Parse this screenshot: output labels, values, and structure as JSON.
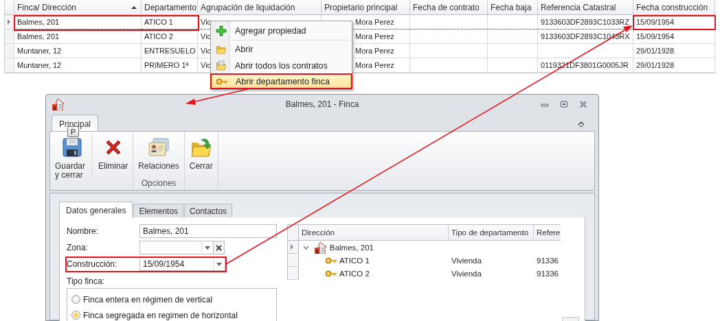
{
  "grid": {
    "columns": [
      {
        "label": "Finca/ Dirección",
        "sorted": true
      },
      {
        "label": "Departamento",
        "sorted": false
      },
      {
        "label": "Agrupación de liquidación",
        "sorted": false
      },
      {
        "label": "Propietario principal",
        "sorted": false
      },
      {
        "label": "Fecha de contrato",
        "sorted": false
      },
      {
        "label": "Fecha baja",
        "sorted": false
      },
      {
        "label": "Referencia Catastral",
        "sorted": false
      },
      {
        "label": "Fecha construcción",
        "sorted": false
      }
    ],
    "rows": [
      {
        "selected": true,
        "cells": [
          "Balmes, 201",
          "ATICO 1",
          "Vic",
          "Mora Perez",
          "",
          "",
          "9133603DF2893C1033RZ",
          "15/09/1954"
        ]
      },
      {
        "selected": false,
        "cells": [
          "Balmes, 201",
          "ATICO 2",
          "Vic",
          "Mora Perez",
          "",
          "",
          "9133603DF2893C1043RX",
          "15/09/1954"
        ]
      },
      {
        "selected": false,
        "cells": [
          "Muntaner, 12",
          "ENTRESUELO",
          "Vic",
          "Mora Perez",
          "",
          "",
          "",
          "29/01/1928"
        ]
      },
      {
        "selected": false,
        "cells": [
          "Muntaner, 12",
          "PRIMERO 1ª",
          "Vic",
          "Mora Perez",
          "",
          "",
          "0119321DF3801G0005JR",
          "29/01/1928"
        ]
      }
    ]
  },
  "context_menu": {
    "items": [
      {
        "label": "Agregar propiedad",
        "kind": "plus",
        "highlighted": false,
        "separator_after": true
      },
      {
        "label": "Abrir",
        "kind": "folder",
        "highlighted": false,
        "separator_after": false
      },
      {
        "label": "Abrir todos los contratos",
        "kind": "folder-docs",
        "highlighted": false,
        "separator_after": false
      },
      {
        "label": "Abrir departamento finca",
        "kind": "key",
        "highlighted": true,
        "separator_after": false
      }
    ]
  },
  "dialog": {
    "title": "Balmes, 201 - Finca",
    "ribbon": {
      "tabs": [
        {
          "label": "Principal",
          "selected": true,
          "keytip": "P"
        }
      ],
      "groups": [
        {
          "buttons": [
            {
              "label": "Guardar y cerrar",
              "kind": "save"
            },
            {
              "label": "Eliminar",
              "kind": "delete"
            }
          ]
        },
        {
          "label": "Opciones",
          "buttons": [
            {
              "label": "Relaciones",
              "kind": "cards"
            }
          ]
        },
        {
          "buttons": [
            {
              "label": "Cerrar",
              "kind": "folder-arrow"
            }
          ]
        }
      ]
    },
    "tabs": [
      {
        "label": "Datos generales",
        "selected": true
      },
      {
        "label": "Elementos",
        "selected": false
      },
      {
        "label": "Contactos",
        "selected": false
      }
    ],
    "fields": [
      {
        "label": "Nombre:",
        "kind": "text",
        "value": "Balmes, 201"
      },
      {
        "label": "Zona:",
        "kind": "combo-clear"
      },
      {
        "label": "Construcción:",
        "kind": "combo",
        "value": "15/09/1954"
      }
    ],
    "tipo_finca": {
      "label": "Tipo finca:",
      "options": [
        {
          "label": "Finca entera en régimen de vertical",
          "selected": false
        },
        {
          "label": "Finca segregada en regimen de horizontal",
          "selected": true
        }
      ]
    },
    "tree": {
      "columns": [
        "Dirección",
        "Tipo de departamento",
        "Refere"
      ],
      "rows": [
        {
          "label": "Balmes, 201",
          "kind": "building",
          "expanded": true,
          "current": true,
          "children": [
            {
              "label": "ATICO 1",
              "kind": "key",
              "type": "Vivienda",
              "reference": "91336"
            },
            {
              "label": "ATICO 2",
              "kind": "key",
              "type": "Vivienda",
              "reference": "91336"
            }
          ]
        }
      ]
    }
  }
}
